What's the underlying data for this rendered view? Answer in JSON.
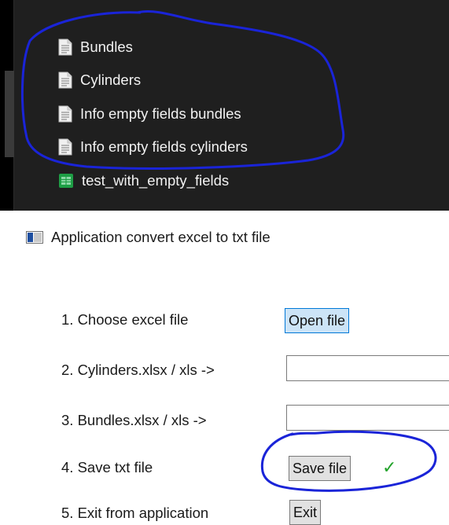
{
  "explorer": {
    "files": [
      {
        "name": "Bundles",
        "icon": "text-document-icon"
      },
      {
        "name": "Cylinders",
        "icon": "text-document-icon"
      },
      {
        "name": "Info empty fields bundles",
        "icon": "text-document-icon"
      },
      {
        "name": "Info empty fields cylinders",
        "icon": "text-document-icon"
      },
      {
        "name": "test_with_empty_fields",
        "icon": "excel-file-icon"
      }
    ]
  },
  "app": {
    "title": "Application convert excel to txt file",
    "steps": {
      "choose_label": "1. Choose excel file",
      "cylinders_label": "2. Cylinders.xlsx / xls ->",
      "bundles_label": "3. Bundles.xlsx / xls ->",
      "save_label": "4. Save txt file",
      "exit_label": "5. Exit from application"
    },
    "buttons": {
      "open": "Open file",
      "save": "Save file",
      "exit": "Exit"
    },
    "fields": {
      "cylinders_value": "",
      "bundles_value": ""
    },
    "status_check": "✓"
  },
  "colors": {
    "annotation": "#1a24d8",
    "check": "#22a32a",
    "primary_button": "#cce4f7"
  }
}
